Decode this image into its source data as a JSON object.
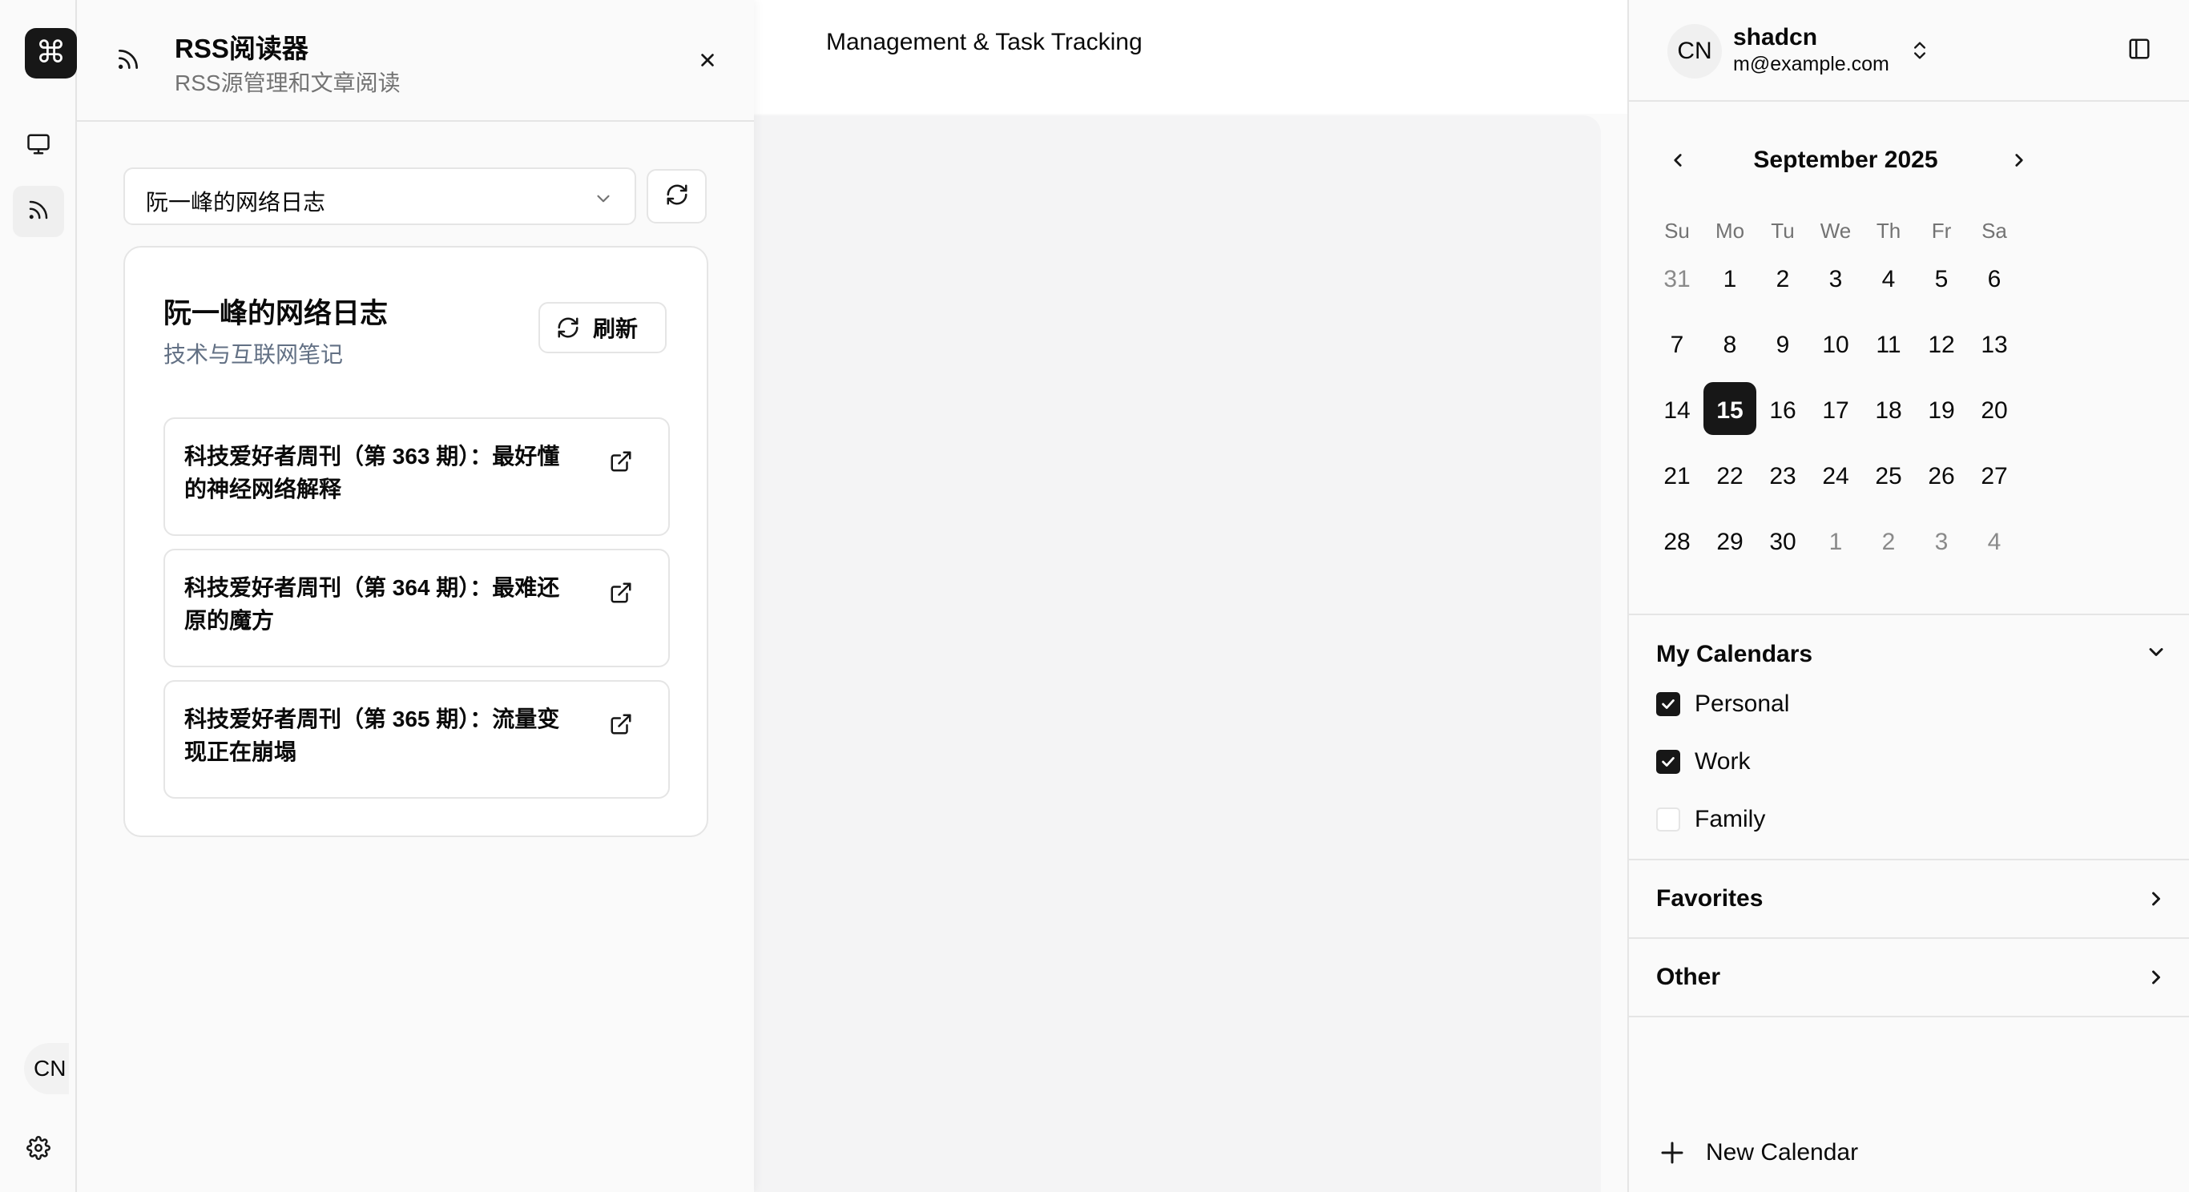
{
  "rail": {
    "logo": "⌘",
    "avatar": "CN"
  },
  "main": {
    "title": "Management & Task Tracking"
  },
  "rss": {
    "title": "RSS阅读器",
    "subtitle": "RSS源管理和文章阅读",
    "selected_feed": "阮一峰的网络日志",
    "feed": {
      "title": "阮一峰的网络日志",
      "description": "技术与互联网笔记",
      "refresh_label": "刷新"
    },
    "articles": [
      {
        "title": "科技爱好者周刊（第 363 期）：最好懂的神经网络解释"
      },
      {
        "title": "科技爱好者周刊（第 364 期）：最难还原的魔方"
      },
      {
        "title": "科技爱好者周刊（第 365 期）：流量变现正在崩塌"
      }
    ]
  },
  "user": {
    "initials": "CN",
    "name": "shadcn",
    "email": "m@example.com"
  },
  "calendar": {
    "month_label": "September 2025",
    "weekdays": [
      "Su",
      "Mo",
      "Tu",
      "We",
      "Th",
      "Fr",
      "Sa"
    ],
    "weeks": [
      [
        "31",
        "1",
        "2",
        "3",
        "4",
        "5",
        "6"
      ],
      [
        "7",
        "8",
        "9",
        "10",
        "11",
        "12",
        "13"
      ],
      [
        "14",
        "15",
        "16",
        "17",
        "18",
        "19",
        "20"
      ],
      [
        "21",
        "22",
        "23",
        "24",
        "25",
        "26",
        "27"
      ],
      [
        "28",
        "29",
        "30",
        "1",
        "2",
        "3",
        "4"
      ]
    ],
    "selected_day": "15"
  },
  "sections": {
    "my_calendars": {
      "title": "My Calendars",
      "items": [
        {
          "label": "Personal",
          "checked": true
        },
        {
          "label": "Work",
          "checked": true
        },
        {
          "label": "Family",
          "checked": false
        }
      ]
    },
    "favorites": {
      "title": "Favorites"
    },
    "other": {
      "title": "Other"
    }
  },
  "new_calendar_label": "New Calendar",
  "colors": {
    "primary": "#171717",
    "border": "#e5e5e5",
    "muted_text": "#737373",
    "description_text": "#627084"
  }
}
